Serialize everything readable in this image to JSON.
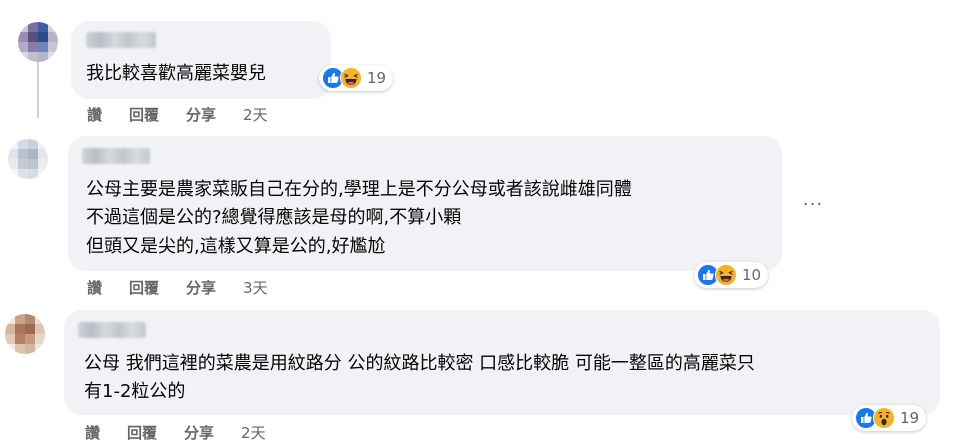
{
  "comments": [
    {
      "text_lines": [
        "我比較喜歡高麗菜嬰兒"
      ],
      "reaction_count": "19",
      "reactions": [
        "like-icon",
        "haha-icon"
      ],
      "actions": {
        "like": "讚",
        "reply": "回覆",
        "share": "分享",
        "time": "2天"
      }
    },
    {
      "text_lines": [
        "公母主要是農家菜販自己在分的,學理上是不分公母或者該說雌雄同體",
        "不過這個是公的?總覺得應該是母的啊,不算小顆",
        "但頭又是尖的,這樣又算是公的,好尷尬"
      ],
      "reaction_count": "10",
      "reactions": [
        "like-icon",
        "haha-icon"
      ],
      "more_label": "···",
      "actions": {
        "like": "讚",
        "reply": "回覆",
        "share": "分享",
        "time": "3天"
      }
    },
    {
      "text_lines": [
        "公母 我們這裡的菜農是用紋路分 公的紋路比較密 口感比較脆 可能一整區的高麗菜只",
        "有1-2粒公的"
      ],
      "reaction_count": "19",
      "reactions": [
        "like-icon",
        "wow-icon"
      ],
      "actions": {
        "like": "讚",
        "reply": "回覆",
        "share": "分享",
        "time": "2天"
      }
    }
  ],
  "colors": {
    "bubble": "#f0f2f5",
    "secondary_text": "#65676b",
    "like_blue": "#1877f2",
    "emoji_yellow": "#f7b125"
  }
}
